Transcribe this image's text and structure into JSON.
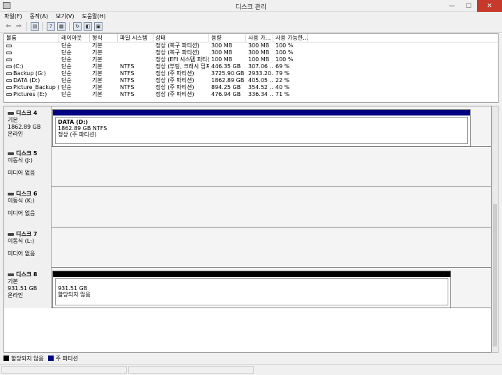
{
  "window": {
    "title": "디스크 관리",
    "minimize_glyph": "—",
    "maximize_glyph": "☐",
    "close_glyph": "✕"
  },
  "menu": [
    "파일(F)",
    "동작(A)",
    "보기(V)",
    "도움말(H)"
  ],
  "toolbar": {
    "icons": [
      "back-arrow-icon",
      "forward-arrow-icon",
      "console-tree-icon",
      "help-icon",
      "properties-icon",
      "refresh-icon",
      "rescan-icon",
      "show-disk-icon"
    ]
  },
  "volume_table": {
    "columns": [
      "볼륨",
      "레이아웃",
      "형식",
      "파일 시스템",
      "상태",
      "용량",
      "사용 가...",
      "사용 가능한..."
    ],
    "rows": [
      {
        "name": "",
        "layout": "단순",
        "type": "기본",
        "fs": "",
        "status": "정상 (복구 파티션)",
        "capacity": "300 MB",
        "free": "300 MB",
        "pct": "100 %"
      },
      {
        "name": "",
        "layout": "단순",
        "type": "기본",
        "fs": "",
        "status": "정상 (복구 파티션)",
        "capacity": "300 MB",
        "free": "300 MB",
        "pct": "100 %"
      },
      {
        "name": "",
        "layout": "단순",
        "type": "기본",
        "fs": "",
        "status": "정상 (EFI 시스템 파티션)",
        "capacity": "100 MB",
        "free": "100 MB",
        "pct": "100 %"
      },
      {
        "name": "(C:)",
        "layout": "단순",
        "type": "기본",
        "fs": "NTFS",
        "status": "정상 (부팅, 크래시 덤프...",
        "capacity": "446.35 GB",
        "free": "307.06 ...",
        "pct": "69 %"
      },
      {
        "name": "Backup (G:)",
        "layout": "단순",
        "type": "기본",
        "fs": "NTFS",
        "status": "정상 (주 파티션)",
        "capacity": "3725.90 GB",
        "free": "2933.20...",
        "pct": "79 %"
      },
      {
        "name": "DATA (D:)",
        "layout": "단순",
        "type": "기본",
        "fs": "NTFS",
        "status": "정상 (주 파티션)",
        "capacity": "1862.89 GB",
        "free": "405.05 ...",
        "pct": "22 %"
      },
      {
        "name": "Picture_Backup (F:)",
        "layout": "단순",
        "type": "기본",
        "fs": "NTFS",
        "status": "정상 (주 파티션)",
        "capacity": "894.25 GB",
        "free": "354.52 ...",
        "pct": "40 %"
      },
      {
        "name": "Pictures (E:)",
        "layout": "단순",
        "type": "기본",
        "fs": "NTFS",
        "status": "정상 (주 파티션)",
        "capacity": "476.94 GB",
        "free": "336.34 ...",
        "pct": "71 %"
      }
    ]
  },
  "disks": [
    {
      "name": "디스크 4",
      "type": "기본",
      "size": "1862.89 GB",
      "state": "온라인",
      "partition": {
        "title": "DATA (D:)",
        "line1": "1862.89 GB NTFS",
        "line2": "정상 (주 파티션)",
        "bar_color": "#000080"
      }
    },
    {
      "name": "디스크 5",
      "type": "이동식 (J:)",
      "size": "",
      "state": "미디어 없음"
    },
    {
      "name": "디스크 6",
      "type": "이동식 (K:)",
      "size": "",
      "state": "미디어 없음"
    },
    {
      "name": "디스크 7",
      "type": "이동식 (L:)",
      "size": "",
      "state": "미디어 없음"
    },
    {
      "name": "디스크 8",
      "type": "기본",
      "size": "931.51 GB",
      "state": "온라인",
      "partition": {
        "title": "",
        "line1": "931.51 GB",
        "line2": "할당되지 않음",
        "bar_color": "#000000"
      }
    }
  ],
  "legend": [
    {
      "label": "할당되지 않음",
      "color": "#000000"
    },
    {
      "label": "주 파티션",
      "color": "#000080"
    }
  ]
}
